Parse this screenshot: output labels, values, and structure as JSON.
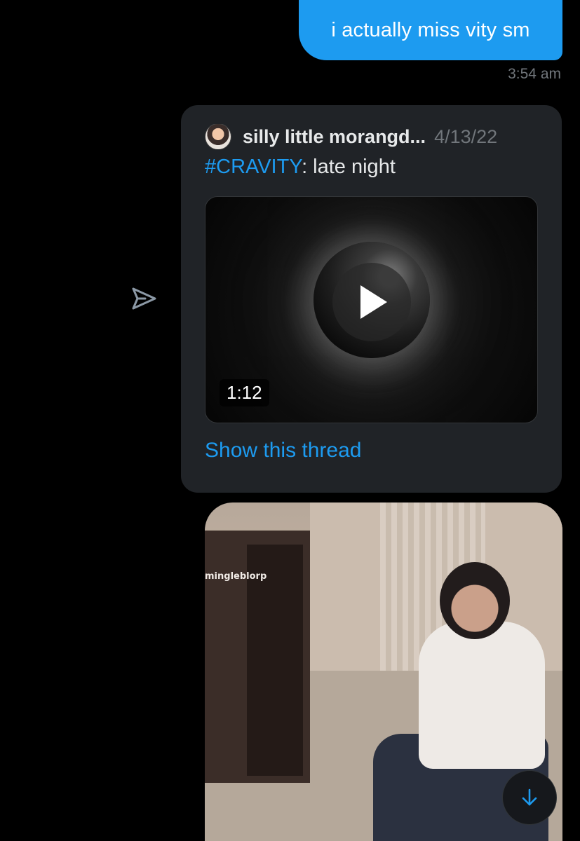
{
  "conversation": {
    "sent_message": {
      "text": "i actually miss vity sm",
      "time": "3:54 am"
    },
    "shared_tweet": {
      "author_name": "silly little morangd...",
      "date": "4/13/22",
      "hashtag": "#CRAVITY",
      "text_rest": ": late night",
      "video_duration": "1:12",
      "show_thread_label": "Show this thread"
    },
    "gif_watermark": "mingleblorp"
  },
  "icons": {
    "share": "share-arrow-icon",
    "play": "play-icon",
    "scroll_down": "arrow-down-icon"
  },
  "colors": {
    "background": "#000000",
    "accent": "#1d9bf0",
    "card": "#202327",
    "muted_text": "#71767b"
  }
}
